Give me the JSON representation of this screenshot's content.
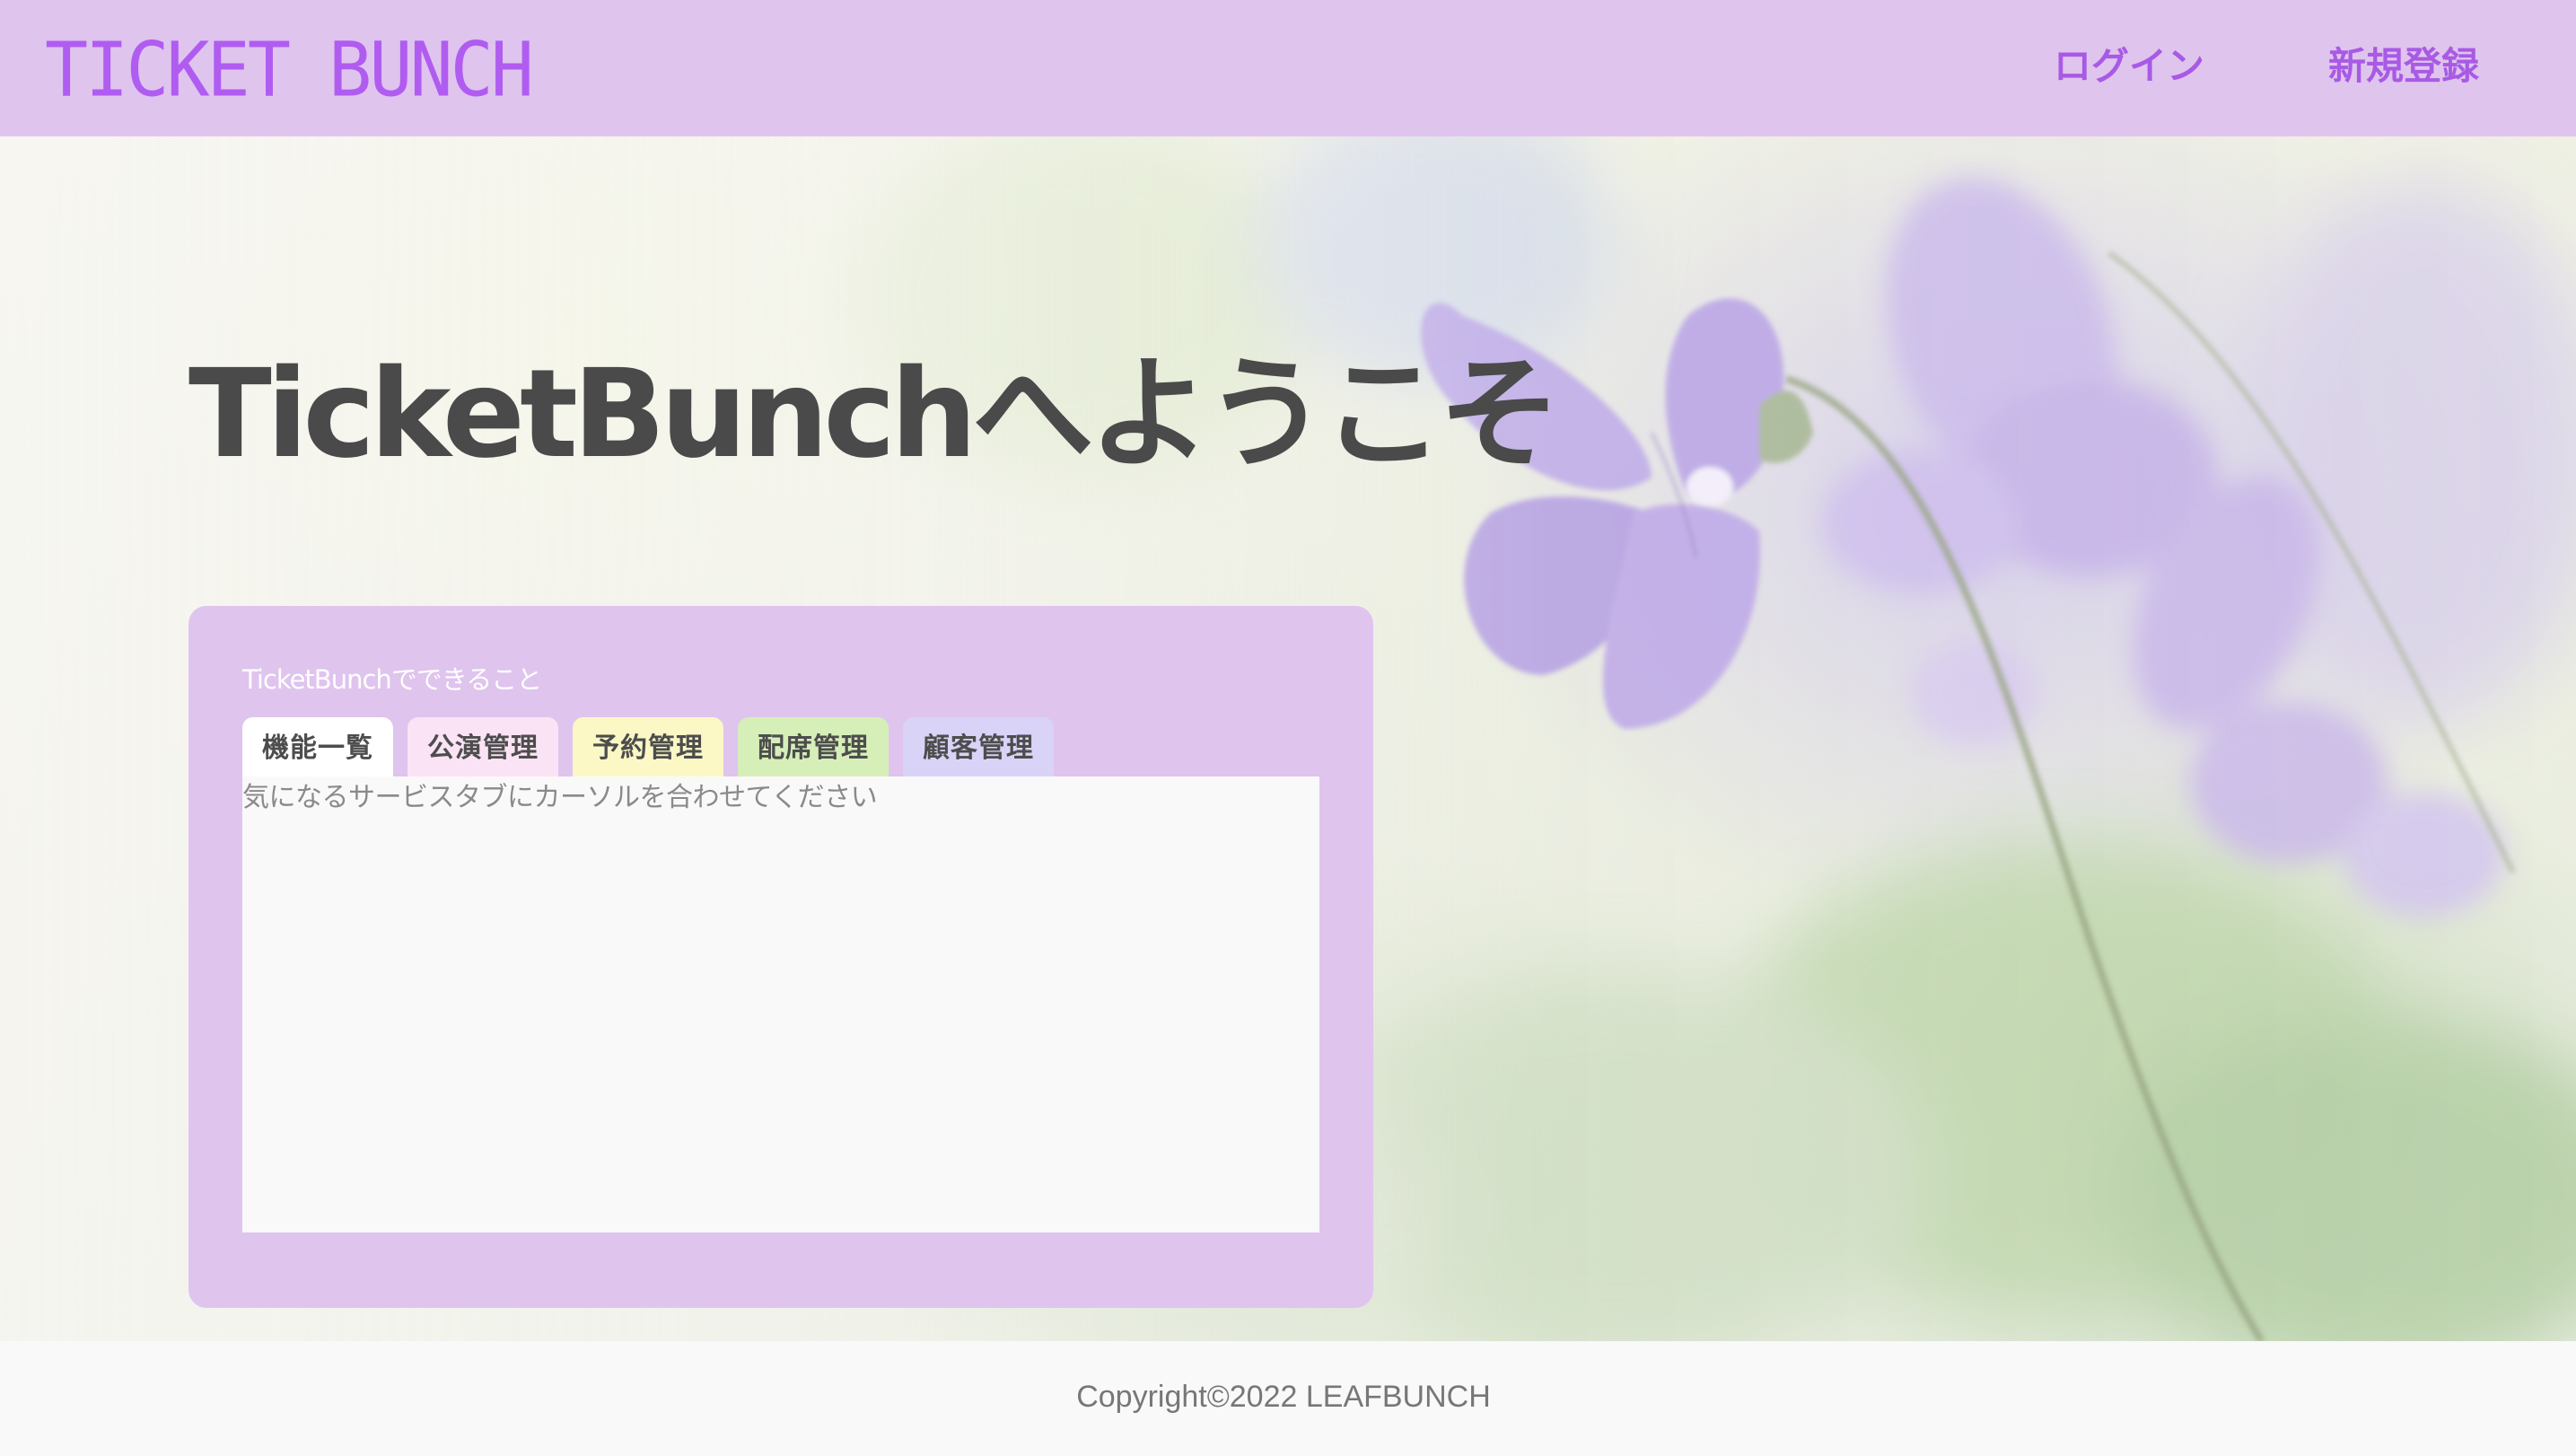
{
  "header": {
    "logo": "TICKET BUNCH",
    "nav": {
      "login": "ログイン",
      "register": "新規登録"
    }
  },
  "hero": {
    "title": "TicketBunchへようこそ",
    "background_icon": "violet-flower-photo"
  },
  "features": {
    "caption": "TicketBunchでできること",
    "tabs": [
      {
        "label": "機能一覧",
        "color": "#ffffff"
      },
      {
        "label": "公演管理",
        "color": "#fbe3f6"
      },
      {
        "label": "予約管理",
        "color": "#fbf8c6"
      },
      {
        "label": "配席管理",
        "color": "#d6efb8"
      },
      {
        "label": "顧客管理",
        "color": "#d9d3f7"
      }
    ],
    "hint": "気になるサービスタブにカーソルを合わせてください"
  },
  "footer": {
    "copyright": "Copyright©2022 LEAFBUNCH"
  },
  "colors": {
    "accent": "#b05cf0",
    "header_bg": "#dfc4ee",
    "panel_bg": "#dfc4ee",
    "title_text": "#4a4a4a"
  }
}
